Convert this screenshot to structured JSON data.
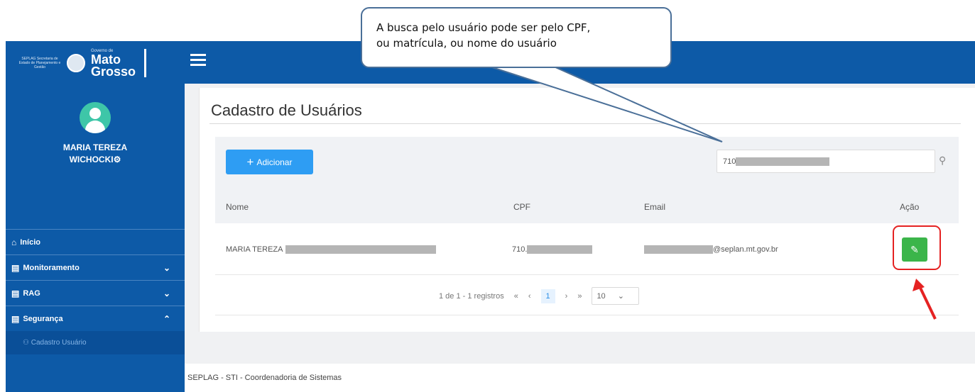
{
  "sidebar": {
    "logo_small_text": "SEPLAG Secretaria de Estado de Planejamento e Gestão",
    "logo_small2": "Governo de",
    "logo_name_1": "Mato",
    "logo_name_2": "Grosso",
    "user_name_1": "MARIA TEREZA",
    "user_name_2": "WICHOCKI",
    "items": [
      {
        "label": "Início",
        "icon": "home-icon"
      },
      {
        "label": "Monitoramento",
        "icon": "building-icon",
        "expanded": false
      },
      {
        "label": "RAG",
        "icon": "building-icon",
        "expanded": false
      },
      {
        "label": "Segurança",
        "icon": "building-icon",
        "expanded": true
      }
    ],
    "subitem": "Cadastro Usuário"
  },
  "page": {
    "title": "Cadastro de Usuários",
    "add_label": "Adicionar",
    "search_value": "710",
    "columns": [
      "Nome",
      "CPF",
      "Email",
      "Ação"
    ],
    "row": {
      "name": "MARIA TEREZA",
      "cpf": "710.",
      "email_suffix": "@seplan.mt.gov.br"
    },
    "pagination": {
      "info": "1 de 1 - 1 registros",
      "first": "«",
      "prev": "‹",
      "current": "1",
      "next": "›",
      "last": "»",
      "page_size": "10"
    },
    "footer": "SEPLAG - STI - Coordenadoria de Sistemas"
  },
  "callout": {
    "line1": "A busca pelo usuário pode ser pelo CPF,",
    "line2": "ou matrícula, ou nome do usuário"
  },
  "colors": {
    "sidebar": "#0d5aa7",
    "primary": "#2e9df3",
    "edit": "#3bb54a",
    "highlight": "#e52222"
  }
}
